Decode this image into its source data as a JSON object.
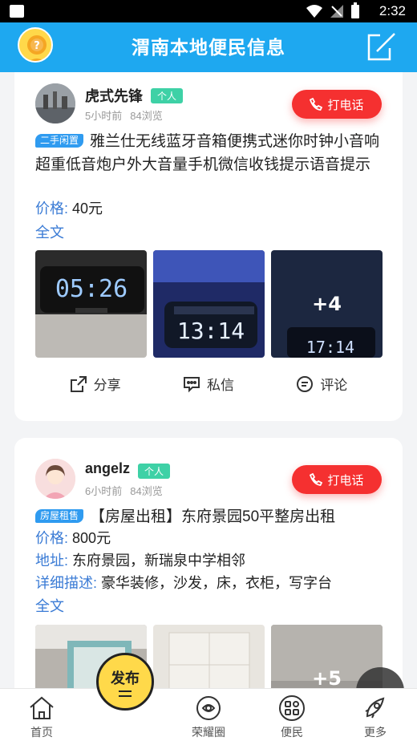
{
  "status_bar": {
    "time": "2:32"
  },
  "app_bar": {
    "title": "渭南本地便民信息"
  },
  "posts": [
    {
      "username": "虎式先锋",
      "role": "个人",
      "time_ago": "5小时前",
      "views": "84浏览",
      "call_label": "打电话",
      "category": "二手闲置",
      "title": "雅兰仕无线蓝牙音箱便携式迷你时钟小音响超重低音炮户外大音量手机微信收钱提示语音提示",
      "fields": [
        {
          "key": "价格:",
          "value": "40元"
        }
      ],
      "full_text": "全文",
      "photo_more": "+4",
      "actions": {
        "share": "分享",
        "message": "私信",
        "comment": "评论"
      }
    },
    {
      "username": "angelz",
      "role": "个人",
      "time_ago": "6小时前",
      "views": "84浏览",
      "call_label": "打电话",
      "category": "房屋租售",
      "title": "【房屋出租】东府景园50平整房出租",
      "fields": [
        {
          "key": "价格:",
          "value": "800元"
        },
        {
          "key": "地址:",
          "value": "东府景园，新瑞泉中学相邻"
        },
        {
          "key": "详细描述:",
          "value": "豪华装修，沙发，床，衣柜，写字台"
        }
      ],
      "full_text": "全文",
      "photo_more": "+5"
    }
  ],
  "bottom_nav": {
    "home": "首页",
    "publish": "发布",
    "honor": "荣耀圈",
    "service": "便民",
    "more": "更多"
  },
  "colors": {
    "accent": "#1ea8f0",
    "call": "#f53030",
    "link": "#3a7bd5",
    "publish": "#ffd94a"
  }
}
